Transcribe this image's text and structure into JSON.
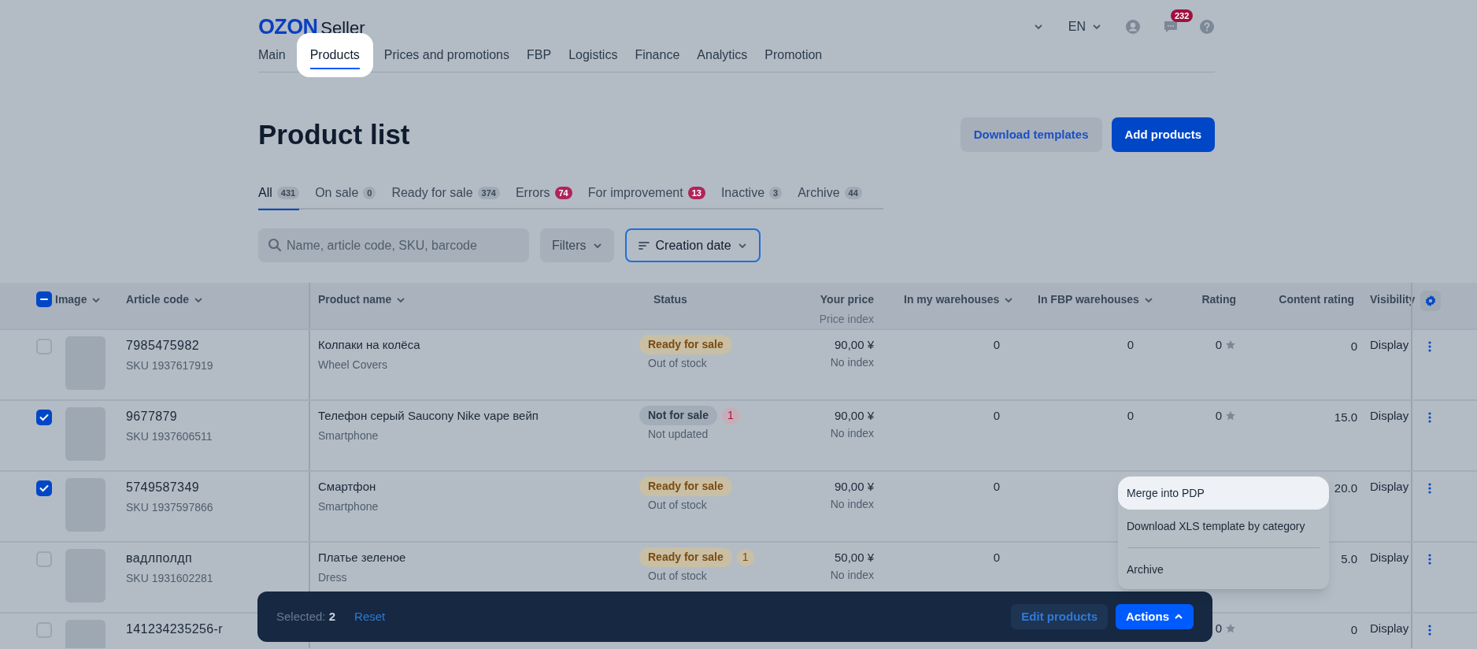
{
  "header": {
    "logo": "OZON",
    "logo_suffix": "Seller",
    "language": "EN",
    "notifications_count": "232"
  },
  "nav": [
    {
      "label": "Main",
      "selected": false
    },
    {
      "label": "Products",
      "selected": true
    },
    {
      "label": "Prices and promotions",
      "selected": false
    },
    {
      "label": "FBP",
      "selected": false
    },
    {
      "label": "Logistics",
      "selected": false
    },
    {
      "label": "Finance",
      "selected": false
    },
    {
      "label": "Analytics",
      "selected": false
    },
    {
      "label": "Promotion",
      "selected": false
    }
  ],
  "page_title": "Product list",
  "buttons": [
    {
      "label": "Download templates",
      "kind": "secondary"
    },
    {
      "label": "Add products",
      "kind": "primary"
    }
  ],
  "tabs": [
    {
      "label": "All",
      "count": "431",
      "alert": false,
      "selected": true
    },
    {
      "label": "On sale",
      "count": "0",
      "alert": false,
      "selected": false
    },
    {
      "label": "Ready for sale",
      "count": "374",
      "alert": false,
      "selected": false
    },
    {
      "label": "Errors",
      "count": "74",
      "alert": true,
      "selected": false
    },
    {
      "label": "For improvement",
      "count": "13",
      "alert": true,
      "selected": false
    },
    {
      "label": "Inactive",
      "count": "3",
      "alert": false,
      "selected": false
    },
    {
      "label": "Archive",
      "count": "44",
      "alert": false,
      "selected": false
    }
  ],
  "search": {
    "placeholder": "Name, article code, SKU, barcode"
  },
  "filters_button": "Filters",
  "sort_button": "Creation date",
  "table": {
    "select_all_indeterminate": true,
    "columns": [
      {
        "label": "Image",
        "sortable": true
      },
      {
        "label": "Article code",
        "sortable": true
      },
      {
        "label": "Product name",
        "sortable": true
      },
      {
        "label": "Status",
        "sortable": false
      },
      {
        "label": "Your price",
        "sublabel": "Price index",
        "sortable": false
      },
      {
        "label": "In my warehouses",
        "sortable": true
      },
      {
        "label": "In FBP warehouses",
        "sortable": true
      },
      {
        "label": "Rating",
        "sortable": false
      },
      {
        "label": "Content rating",
        "sortable": false
      },
      {
        "label": "Visibility",
        "sortable": false
      }
    ],
    "rows": [
      {
        "checked": false,
        "article": "7985475982",
        "sku": "SKU 1937617919",
        "name": "Колпаки на колёса",
        "category": "Wheel Covers",
        "status": {
          "label": "Ready for sale",
          "kind": "ready"
        },
        "status_note": "Out of stock",
        "price": "90,00 ¥",
        "price_index": "No index",
        "my_wh": "0",
        "fbp_wh": "0",
        "rating": "0",
        "content_rating": "0",
        "visibility": "Display"
      },
      {
        "checked": true,
        "article": "9677879",
        "sku": "SKU 1937606511",
        "name": "Телефон серый Saucony Nike vape вейп",
        "category": "Smartphone",
        "status": {
          "label": "Not for sale",
          "kind": "not_for_sale"
        },
        "issues": "1",
        "status_note": "Not updated",
        "price": "90,00 ¥",
        "price_index": "No index",
        "my_wh": "0",
        "fbp_wh": "0",
        "rating": "0",
        "content_rating": "15.0",
        "visibility": "Display"
      },
      {
        "checked": true,
        "article": "5749587349",
        "sku": "SKU 1937597866",
        "name": "Смартфон",
        "category": "Smartphone",
        "status": {
          "label": "Ready for sale",
          "kind": "ready"
        },
        "status_note": "Out of stock",
        "price": "90,00 ¥",
        "price_index": "No index",
        "my_wh": "0",
        "content_rating": "20.0",
        "visibility": "Display"
      },
      {
        "checked": false,
        "article": "вадлполдп",
        "sku": "SKU 1931602281",
        "name": "Платье зеленое",
        "category": "Dress",
        "status": {
          "label": "Ready for sale",
          "kind": "ready"
        },
        "issues": "1",
        "status_note": "Out of stock",
        "price": "50,00 ¥",
        "price_index": "No index",
        "my_wh": "0",
        "content_rating": "5.0",
        "visibility": "Display"
      },
      {
        "checked": false,
        "article": "141234235256-r",
        "rating": "0",
        "content_rating": "0",
        "visibility": "Display"
      }
    ]
  },
  "selection_bar": {
    "label": "Selected:",
    "count": "2",
    "reset": "Reset",
    "edit": "Edit products",
    "actions": "Actions"
  },
  "actions_menu": [
    {
      "label": "Merge into PDP",
      "selected": true
    },
    {
      "label": "Download XLS template by category",
      "selected": false
    },
    {
      "label": "Archive",
      "selected": false
    }
  ]
}
